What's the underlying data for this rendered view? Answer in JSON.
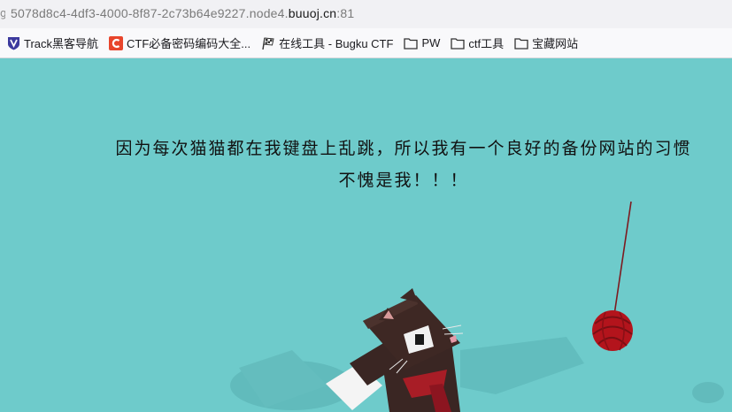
{
  "address_bar": {
    "subdomain": "5078d8c4-4df3-4000-8f87-2c73b64e9227.node4.",
    "domain": "buuoj.cn",
    "port": ":81"
  },
  "bookmarks": [
    {
      "label": "Track黑客导航",
      "icon": "shield-logo-icon"
    },
    {
      "label": "CTF必备密码编码大全...",
      "icon": "c-logo-icon"
    },
    {
      "label": "在线工具 - Bugku CTF",
      "icon": "checkered-flag-icon"
    },
    {
      "label": "PW",
      "icon": "folder-icon"
    },
    {
      "label": "ctf工具",
      "icon": "folder-icon"
    },
    {
      "label": "宝藏网站",
      "icon": "folder-icon"
    }
  ],
  "page": {
    "headline_line1": "因为每次猫猫都在我键盘上乱跳，所以我有一个良好的备份网站的习惯",
    "headline_line2": "不愧是我！！！",
    "background_color": "#6ecbcb",
    "scene": "cat-playing-with-yarn-ball"
  }
}
